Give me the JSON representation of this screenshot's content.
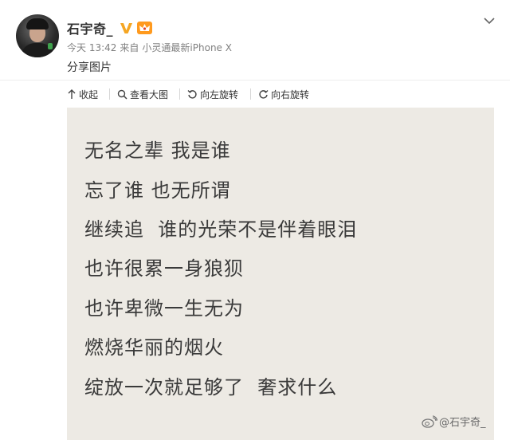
{
  "post": {
    "username": "石宇奇_",
    "meta": {
      "time": "今天 13:42",
      "from_label": "来自",
      "device": "小灵通最新iPhone X"
    },
    "text": "分享图片"
  },
  "toolbar": {
    "collapse": "收起",
    "view_large": "查看大图",
    "rotate_left": "向左旋转",
    "rotate_right": "向右旋转"
  },
  "image": {
    "lines": [
      "无名之辈 我是谁",
      "忘了谁 也无所谓",
      "继续追  谁的光荣不是伴着眼泪",
      "也许很累一身狼狈",
      "也许卑微一生无为",
      "燃烧华丽的烟火",
      "绽放一次就足够了  奢求什么"
    ],
    "watermark": "@石宇奇_"
  },
  "colors": {
    "verified": "#f5a623",
    "vip_badge": "#ff9a1e",
    "image_bg": "#edeae4"
  },
  "icons": [
    "avatar",
    "verified-icon",
    "vip-icon",
    "chevron-down-icon",
    "collapse-icon",
    "zoom-icon",
    "rotate-left-icon",
    "rotate-right-icon",
    "weibo-logo-icon"
  ]
}
